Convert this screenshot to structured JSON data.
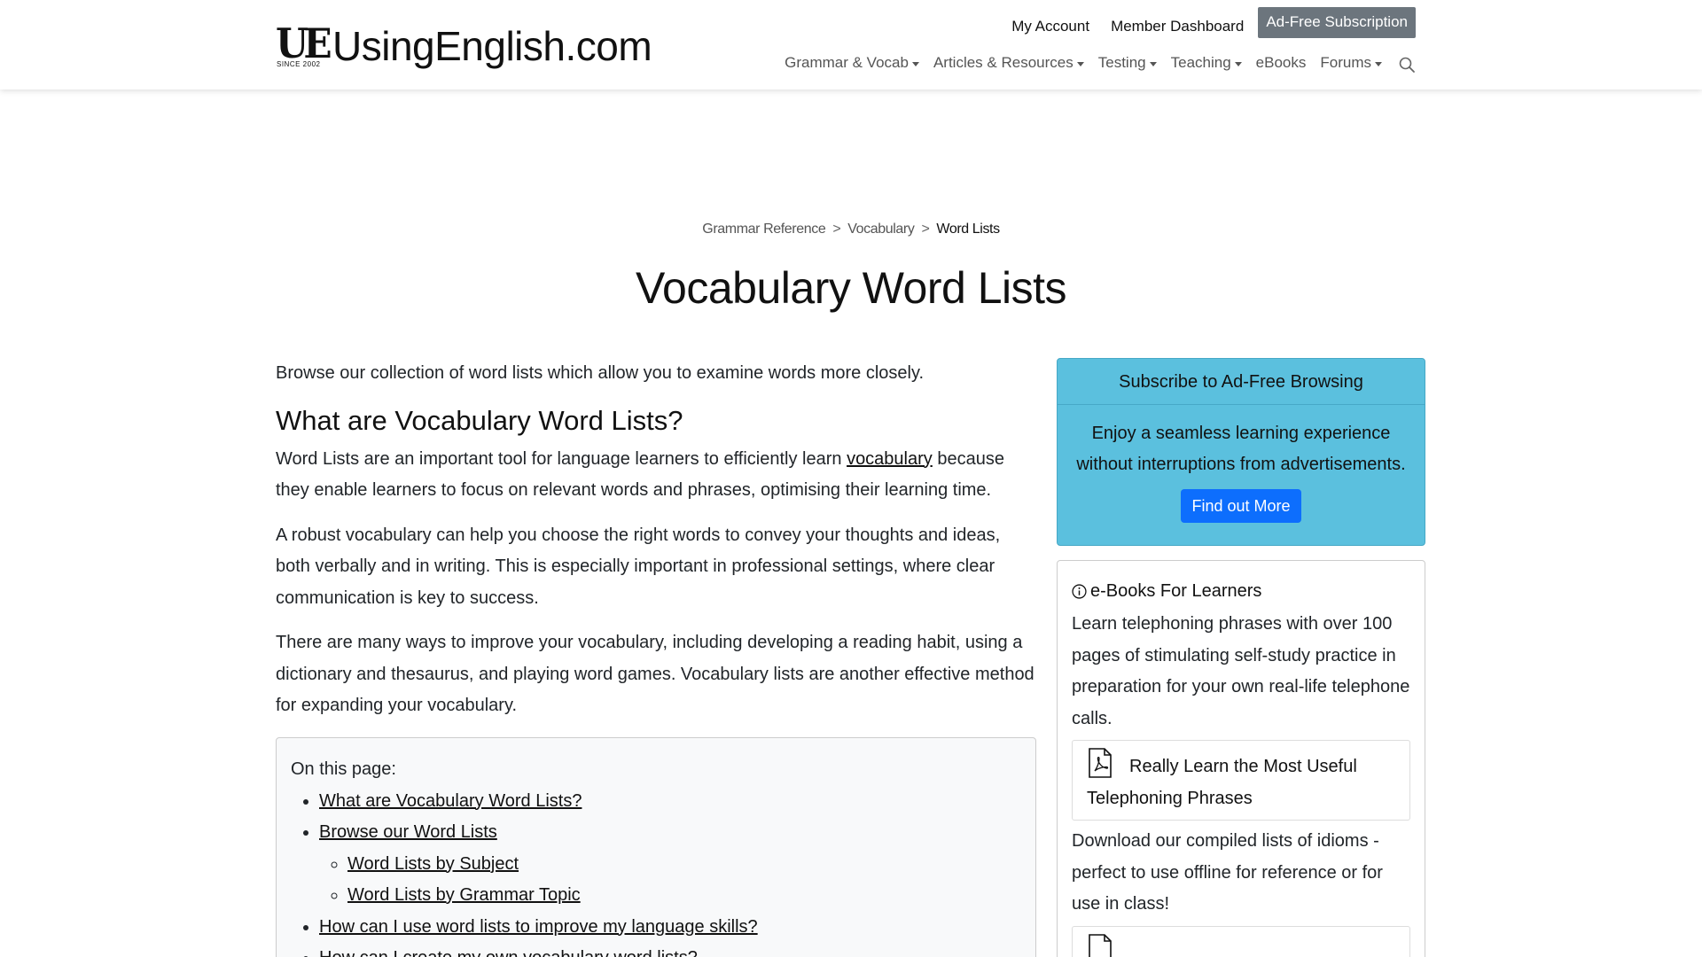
{
  "header": {
    "logo": {
      "mark": "UE",
      "since": "SINCE 2002",
      "text_using": "Using",
      "text_english": "English",
      "text_domain": ".com"
    },
    "top_links": {
      "my_account": "My Account",
      "member_dashboard": "Member Dashboard",
      "ad_free": "Ad-Free Subscription"
    },
    "nav": [
      {
        "label": "Grammar & Vocab",
        "dropdown": true
      },
      {
        "label": "Articles & Resources",
        "dropdown": true
      },
      {
        "label": "Testing",
        "dropdown": true
      },
      {
        "label": "Teaching",
        "dropdown": true
      },
      {
        "label": "eBooks",
        "dropdown": false
      },
      {
        "label": "Forums",
        "dropdown": true
      }
    ]
  },
  "breadcrumb": {
    "items": [
      "Grammar Reference",
      "Vocabulary"
    ],
    "current": "Word Lists",
    "separator": ">"
  },
  "page_title": "Vocabulary Word Lists",
  "content": {
    "intro": "Browse our collection of word lists which allow you to examine words more closely.",
    "heading": "What are Vocabulary Word Lists?",
    "p1_before": "Word Lists are an important tool for language learners to efficiently learn ",
    "p1_link": "vocabulary",
    "p1_after": " because they enable learners to focus on relevant words and phrases, optimising their learning time.",
    "p2": "A robust vocabulary can help you choose the right words to convey your thoughts and ideas, both verbally and in writing. This is especially important in professional settings, where clear communication is key to success.",
    "p3": "There are many ways to improve your vocabulary, including developing a reading habit, using a dictionary and thesaurus, and playing word games. Vocabulary lists are another effective method for expanding your vocabulary."
  },
  "toc": {
    "title": "On this page:",
    "items": [
      "What are Vocabulary Word Lists?",
      "Browse our Word Lists",
      "How can I use word lists to improve my language skills?",
      "How can I create my own vocabulary word lists?"
    ],
    "sub_items": [
      "Word Lists by Subject",
      "Word Lists by Grammar Topic"
    ]
  },
  "promo": {
    "title": "Subscribe to Ad-Free Browsing",
    "body_line1": "Enjoy a seamless learning experience",
    "body_line2": "without interruptions from advertisements.",
    "button": "Find out More"
  },
  "ebooks": {
    "title": "e-Books For Learners",
    "desc1": "Learn telephoning phrases with over 100 pages of stimulating self-study practice in preparation for your own real-life telephone calls.",
    "book1": "Really Learn the Most Useful Telephoning Phrases",
    "desc2": "Download our compiled lists of idioms - perfect to use offline for reference or for use in class!"
  },
  "colors": {
    "promo_bg": "#5bc0de",
    "button_blue": "#0d6efd",
    "adfree_gray": "#6c757d"
  }
}
